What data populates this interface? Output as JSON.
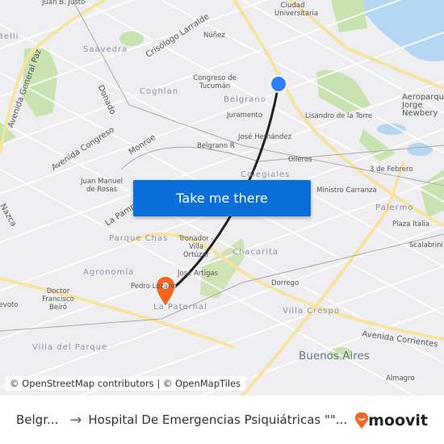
{
  "map": {
    "labels": [
      "Juan B. Justo",
      "telli",
      "Saavedra",
      "Crisólogo Larralde",
      "Núñez",
      "Ciudad Universitaria",
      "Congreso de Tucumán",
      "Coghlan",
      "Belgrano",
      "Juramento",
      "Lisandro de la Torre",
      "José Hernández",
      "Belgrano R",
      "Olleros",
      "Donado",
      "Avenida General Paz",
      "Avenida Congreso",
      "Monroe",
      "Juan Manuel de Rosas",
      "Colegiales",
      "3 de Febrero",
      "Ministro Carranza",
      "Aeroparque Jorge Newbery",
      "Palermo",
      "Plaza Italia",
      "Scalabrini Ortiz",
      "Nazca",
      "La Pampa",
      "Parque Chas",
      "Tronador - Villa Ortúzar",
      "Chacarita",
      "Agronomía",
      "José Artigas",
      "Pedro Lozano",
      "Doctor Francisco Beiró",
      "La Paternal",
      "Dorrego",
      "Villa Crespo",
      "Avenida Corrientes",
      "Villa del Parque",
      "Buenos Aires",
      "Almagro",
      "Devoto"
    ],
    "origin_marker_color": "#2f7df6",
    "destination_marker_color": "#f26522",
    "route_color": "#222222"
  },
  "cta": {
    "label": "Take me there",
    "color": "#0a6fd8"
  },
  "attribution": "© OpenStreetMap contributors | © OpenMapTiles",
  "footer": {
    "from": "Belgr...",
    "arrow": "→",
    "to": "Hospital De Emergencias Psiquiátricas \"\"...",
    "logo": "moovit",
    "logo_color": "#f26522"
  }
}
